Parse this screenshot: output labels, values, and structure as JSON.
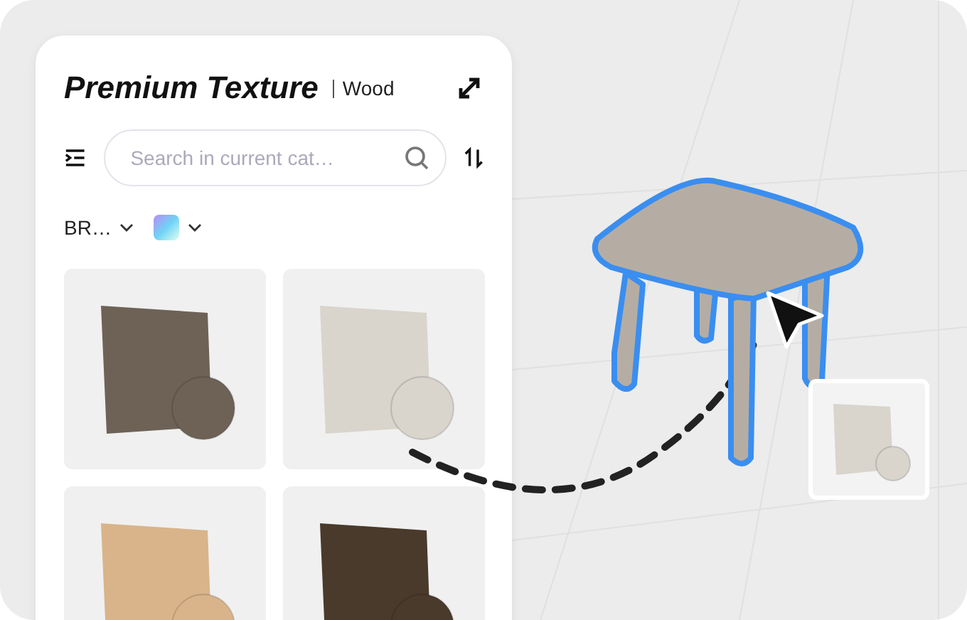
{
  "panel": {
    "title": "Premium Texture",
    "category": "Wood",
    "search": {
      "placeholder": "Search in current cat…"
    },
    "filter": {
      "label": "BR…"
    },
    "tiles": [
      {
        "color": "#6e6257"
      },
      {
        "color": "#d9d4cc"
      },
      {
        "color": "#d9b48a"
      },
      {
        "color": "#4a3a2c"
      }
    ]
  }
}
